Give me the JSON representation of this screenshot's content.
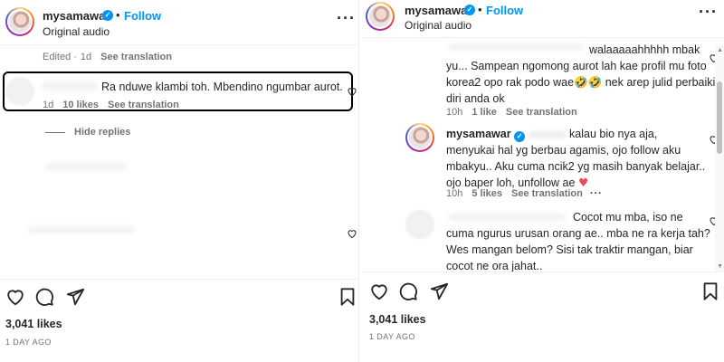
{
  "left": {
    "header": {
      "username": "mysamawar",
      "separator": "•",
      "follow_label": "Follow",
      "subtitle": "Original audio"
    },
    "caption_meta": {
      "edited": "Edited",
      "separator": "·",
      "age": "1d",
      "see_translation": "See translation"
    },
    "highlighted_comment": {
      "text": "Ra nduwe klambi toh. Mbendino ngumbar aurot.",
      "age": "1d",
      "likes": "10 likes",
      "see_translation": "See translation"
    },
    "hide_replies_label": "Hide replies",
    "likes_count": "3,041 likes",
    "time_ago": "1 DAY AGO"
  },
  "right": {
    "header": {
      "username": "mysamawar",
      "separator": "•",
      "follow_label": "Follow",
      "subtitle": "Original audio"
    },
    "comment1": {
      "lines": [
        "walaaaaahhhhh mbak",
        "yu... Sampean ngomong aurot lah kae profil mu foto",
        "korea2 opo rak podo wae",
        "nek arep julid perbaiki",
        "diri anda ok"
      ],
      "emojis": "🤣🤣",
      "age": "10h",
      "likes": "1 like",
      "see_translation": "See translation"
    },
    "reply": {
      "username": "mysamawar",
      "lines": [
        "kalau bio nya aja,",
        "menyukai hal yg berbau agamis, ojo follow aku",
        "mbakyu.. Aku cuma ncik2 yg masih banyak belajar..",
        "ojo baper loh, unfollow ae"
      ],
      "heart_emoji": "♥",
      "age": "10h",
      "likes": "5 likes",
      "see_translation": "See translation"
    },
    "comment3": {
      "lines": [
        "Cocot mu mba, iso ne",
        "cuma ngurus urusan orang ae.. mba ne ra kerja tah?",
        "Wes mangan belom? Sisi tak traktir mangan, biar",
        "cocot ne ora jahat.."
      ]
    },
    "likes_count": "3,041 likes",
    "time_ago": "1 DAY AGO"
  },
  "colors": {
    "accent": "#0095f6",
    "text": "#262626",
    "secondary": "#737373",
    "heart_red": "#ed4956"
  }
}
